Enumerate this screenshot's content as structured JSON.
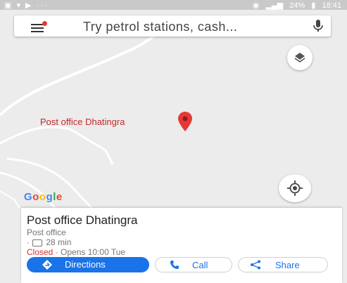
{
  "status_bar": {
    "left_icons": [
      "image-icon",
      "wifi-icon",
      "youtube-icon",
      "more-icon"
    ],
    "right_text": "24%",
    "time": "18:41"
  },
  "search": {
    "placeholder": "Try petrol stations, cash..."
  },
  "map": {
    "place_label": "Post office Dhatingra",
    "logo_text": [
      "G",
      "o",
      "o",
      "g",
      "l",
      "e"
    ]
  },
  "place_card": {
    "title": "Post office Dhatingra",
    "type": "Post office",
    "travel_prefix": "·",
    "travel_time": "28 min",
    "status_closed": "Closed",
    "status_opens": " · Opens 10:00 Tue"
  },
  "actions": {
    "directions": "Directions",
    "call": "Call",
    "share": "Share"
  },
  "colors": {
    "accent": "#1a73e8",
    "closed": "#d32f2f",
    "pin": "#e53935"
  }
}
